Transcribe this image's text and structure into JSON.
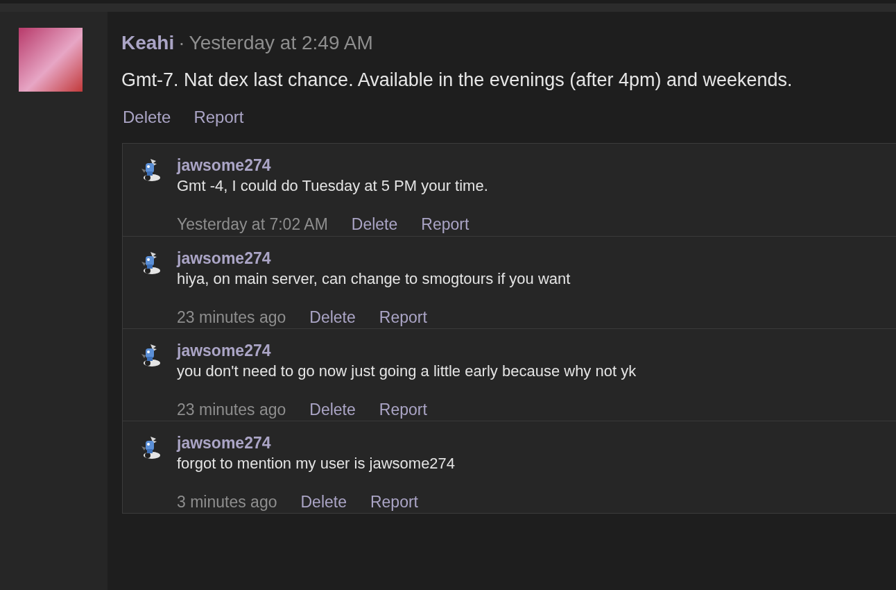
{
  "post": {
    "author": "Keahi",
    "separator": "·",
    "time": "Yesterday at 2:49 AM",
    "message": "Gmt-7. Nat dex last chance. Available in the evenings (after 4pm) and weekends.",
    "actions": [
      "Delete",
      "Report"
    ]
  },
  "replies": [
    {
      "author": "jawsome274",
      "message": "Gmt -4, I could do Tuesday at 5 PM your time.",
      "time": "Yesterday at 7:02 AM",
      "actions": [
        "Delete",
        "Report"
      ]
    },
    {
      "author": "jawsome274",
      "message": "hiya, on main server, can change to smogtours if you want",
      "time": "23 minutes ago",
      "actions": [
        "Delete",
        "Report"
      ]
    },
    {
      "author": "jawsome274",
      "message": "you don't need to go now just going a little early because why not yk",
      "time": "23 minutes ago",
      "actions": [
        "Delete",
        "Report"
      ]
    },
    {
      "author": "jawsome274",
      "message": "forgot to mention my user is jawsome274",
      "time": "3 minutes ago",
      "actions": [
        "Delete",
        "Report"
      ]
    }
  ]
}
